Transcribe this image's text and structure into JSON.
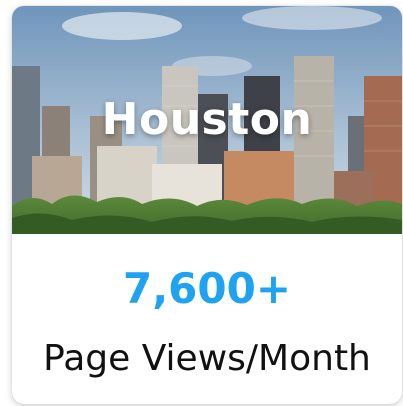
{
  "card": {
    "city": "Houston",
    "value": "7,600+",
    "label": "Page Views/Month"
  },
  "colors": {
    "accent": "#1fa3f0",
    "label": "#111111",
    "sky_top": "#7fa2c2",
    "sky_bottom": "#c9d6e2"
  },
  "image": {
    "subject": "houston-skyline-photo"
  }
}
